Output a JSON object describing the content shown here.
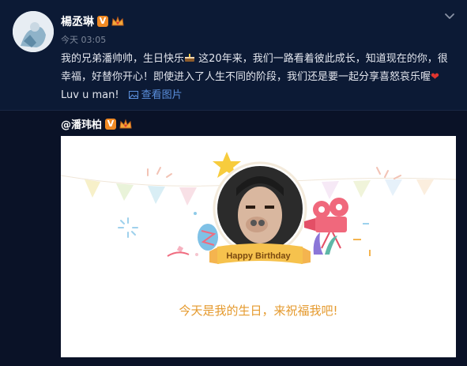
{
  "post": {
    "username": "楊丞琳",
    "timestamp": "今天 03:05",
    "text_part1": "我的兄弟潘帅帅，生日快乐",
    "text_part2": " 这20年来，我们一路看着彼此成长，知道现在的你，很幸福，好替你开心！即使进入了人生不同的阶段，我们还是要一起分享喜怒哀乐喔",
    "text_part3": " Luv u man!",
    "view_images_label": "查看图片"
  },
  "repost": {
    "username": "@潘玮柏",
    "card_banner": "Happy Birthday",
    "card_caption": "今天是我的生日，来祝福我吧!"
  },
  "colors": {
    "background": "#0c1a35",
    "link": "#5a8fdc",
    "caption": "#e59a2e",
    "heart": "#e0352f",
    "badge": "#f08a24"
  },
  "icons": [
    "chevron-down-icon",
    "verified-icon",
    "crown-icon",
    "cake-icon",
    "heart-icon",
    "image-icon"
  ]
}
